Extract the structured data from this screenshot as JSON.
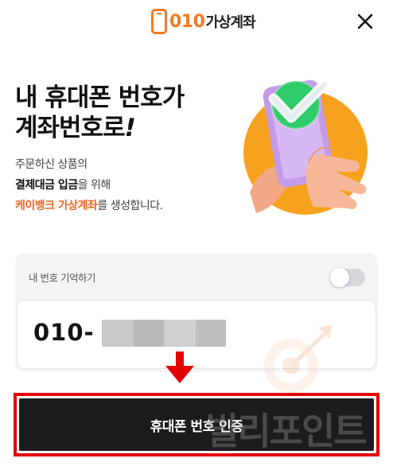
{
  "header": {
    "logo_number": "010",
    "logo_text": "가상계좌",
    "close_icon": "close-icon"
  },
  "headline": {
    "line1": "내 휴대폰 번호가",
    "line2": "계좌번호로",
    "exclaim": "!"
  },
  "description": {
    "line1": "주문하신 상품의",
    "line2_bold": "결제대금 입금",
    "line2_rest": "을 위해",
    "line3_accent": "케이뱅크 가상계좌",
    "line3_rest": "를 생성합니다."
  },
  "illustration": {
    "icon": "phone-check-illustration",
    "colors": {
      "circle": "#f7a21e",
      "phone": "#c39be8",
      "check": "#2fcc6a",
      "hand": "#f7b89a"
    }
  },
  "form": {
    "remember_label": "내 번호 기억하기",
    "remember_toggle_on": false,
    "phone_prefix": "010-"
  },
  "watermark": {
    "text": "빌리포인트",
    "icon": "target-icon"
  },
  "cta": {
    "label": "휴대폰 번호 인증"
  },
  "colors": {
    "accent": "#f26522",
    "highlight": "#e50000",
    "button_bg": "#1c1c1e",
    "brand": "#f47a25"
  }
}
